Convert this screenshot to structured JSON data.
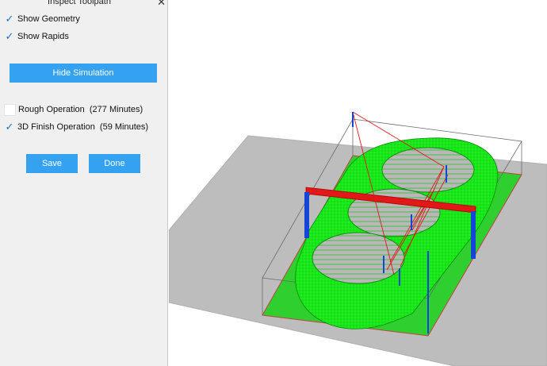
{
  "window": {
    "title": "Inspect Toolpath",
    "close_glyph": "✕"
  },
  "display_options": [
    {
      "label": "Show Geometry",
      "checked": true
    },
    {
      "label": "Show Rapids",
      "checked": true
    }
  ],
  "simulation_button": {
    "label": "Hide Simulation"
  },
  "operations": [
    {
      "label": "Rough Operation  (277 Minutes)",
      "checked": false
    },
    {
      "label": "3D Finish Operation  (59 Minutes)",
      "checked": true
    }
  ],
  "actions": {
    "save_label": "Save",
    "done_label": "Done"
  },
  "icons": {
    "checkbox": "checkmark-icon",
    "close": "close-icon"
  },
  "colors": {
    "button": "#34a2f1",
    "checkmark": "#1a73c9",
    "stock_plane": "#bdbdbd",
    "toolpath": "#1cf01c",
    "rapids": "#e01818",
    "tool_bars": "#1444d8"
  }
}
